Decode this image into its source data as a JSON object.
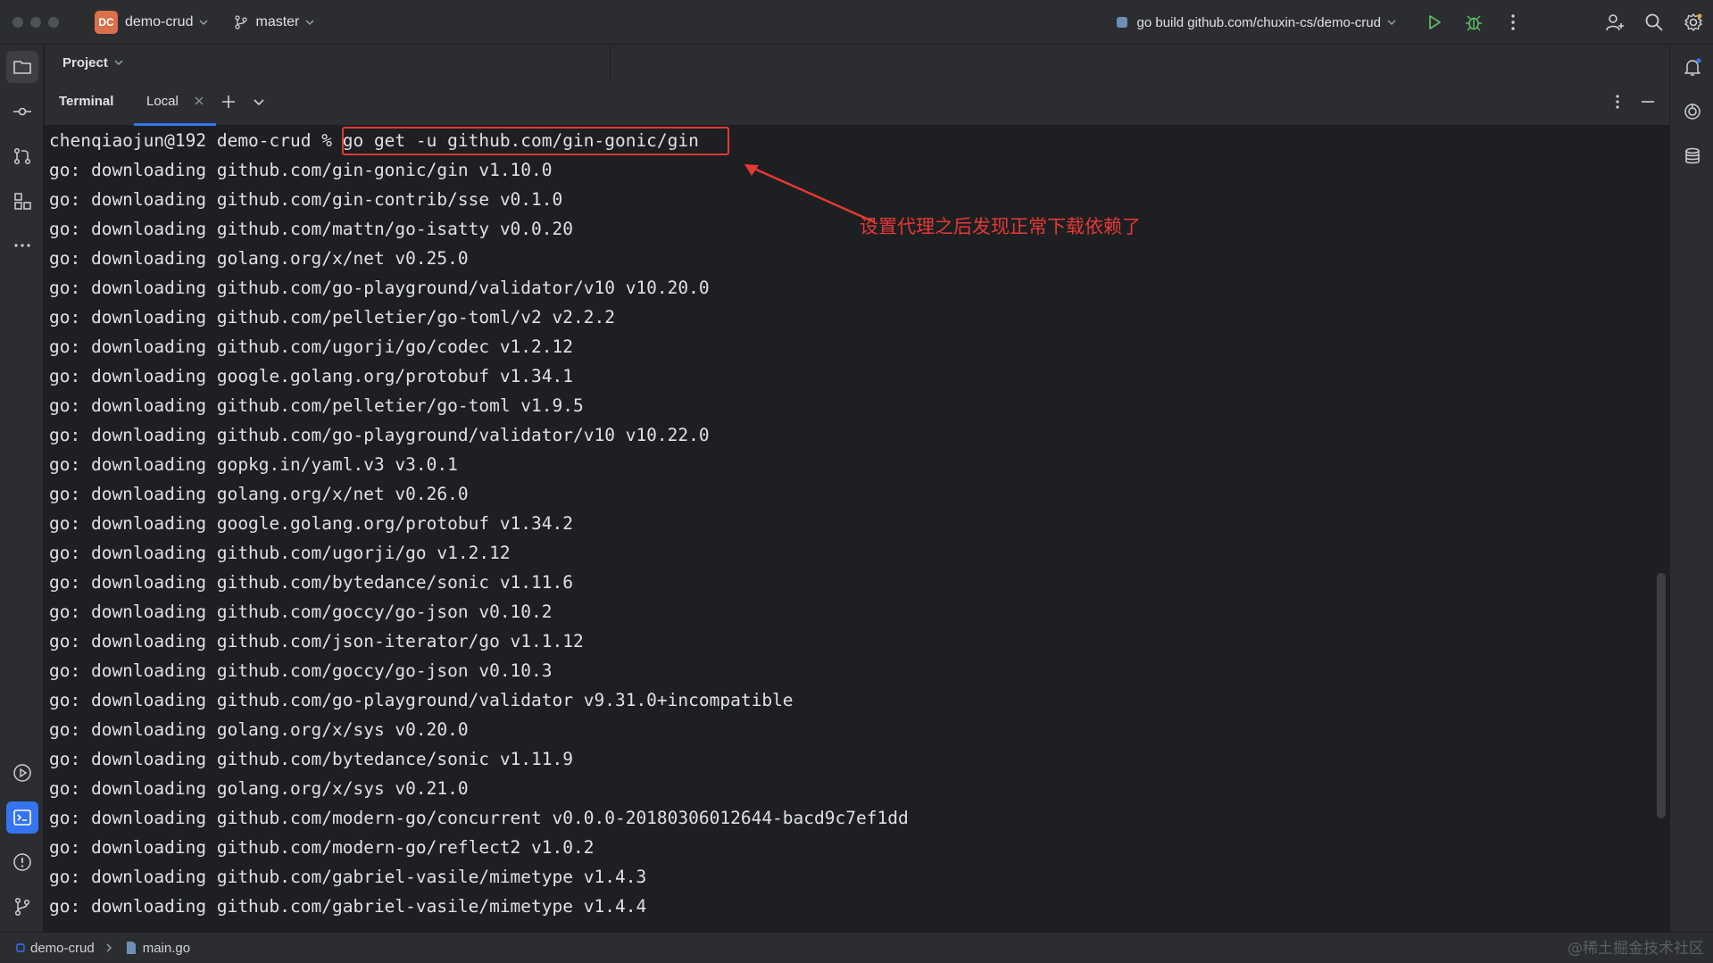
{
  "titlebar": {
    "project_badge": "DC",
    "project_name": "demo-crud",
    "branch": "master",
    "run_config": "go build github.com/chuxin-cs/demo-crud"
  },
  "project_panel": {
    "title": "Project"
  },
  "terminal": {
    "title": "Terminal",
    "tab_label": "Local",
    "lines": [
      "chenqiaojun@192 demo-crud % go get -u github.com/gin-gonic/gin",
      "go: downloading github.com/gin-gonic/gin v1.10.0",
      "go: downloading github.com/gin-contrib/sse v0.1.0",
      "go: downloading github.com/mattn/go-isatty v0.0.20",
      "go: downloading golang.org/x/net v0.25.0",
      "go: downloading github.com/go-playground/validator/v10 v10.20.0",
      "go: downloading github.com/pelletier/go-toml/v2 v2.2.2",
      "go: downloading github.com/ugorji/go/codec v1.2.12",
      "go: downloading google.golang.org/protobuf v1.34.1",
      "go: downloading github.com/pelletier/go-toml v1.9.5",
      "go: downloading github.com/go-playground/validator/v10 v10.22.0",
      "go: downloading gopkg.in/yaml.v3 v3.0.1",
      "go: downloading golang.org/x/net v0.26.0",
      "go: downloading google.golang.org/protobuf v1.34.2",
      "go: downloading github.com/ugorji/go v1.2.12",
      "go: downloading github.com/bytedance/sonic v1.11.6",
      "go: downloading github.com/goccy/go-json v0.10.2",
      "go: downloading github.com/json-iterator/go v1.1.12",
      "go: downloading github.com/goccy/go-json v0.10.3",
      "go: downloading github.com/go-playground/validator v9.31.0+incompatible",
      "go: downloading golang.org/x/sys v0.20.0",
      "go: downloading github.com/bytedance/sonic v1.11.9",
      "go: downloading golang.org/x/sys v0.21.0",
      "go: downloading github.com/modern-go/concurrent v0.0.0-20180306012644-bacd9c7ef1dd",
      "go: downloading github.com/modern-go/reflect2 v1.0.2",
      "go: downloading github.com/gabriel-vasile/mimetype v1.4.3",
      "go: downloading github.com/gabriel-vasile/mimetype v1.4.4"
    ],
    "annotation": "设置代理之后发现正常下载依赖了"
  },
  "statusbar": {
    "project": "demo-crud",
    "file": "main.go"
  },
  "watermark": "@稀土掘金技术社区",
  "colors": {
    "accent": "#3574f0",
    "annotation_red": "#e53935",
    "badge": "#d9704a",
    "run_green": "#5fb865"
  }
}
